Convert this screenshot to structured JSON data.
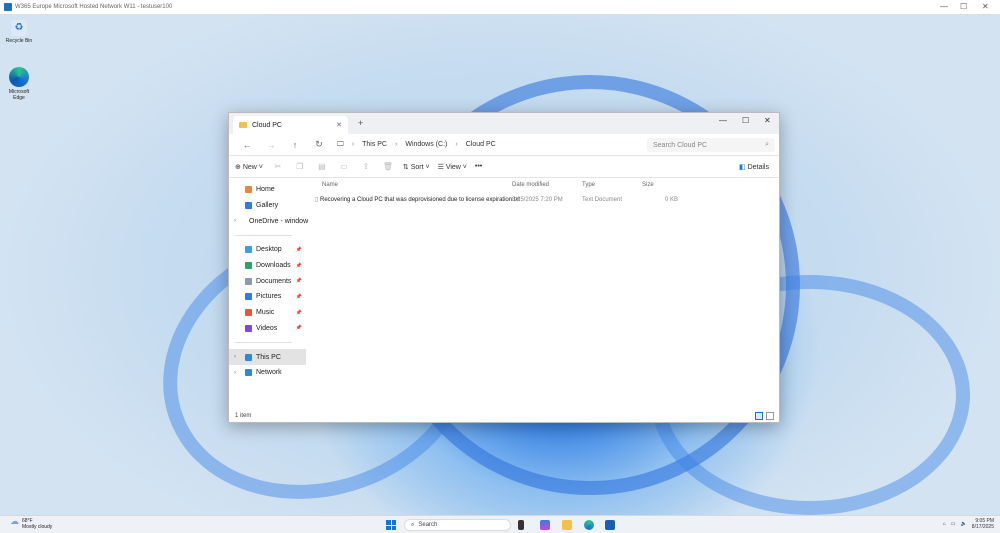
{
  "rdp": {
    "title": "W365 Europe Microsoft Hosted Network W11 - testuser100"
  },
  "desktop": {
    "icons": [
      {
        "label": "Recycle Bin"
      },
      {
        "label": "Microsoft Edge"
      }
    ]
  },
  "explorer": {
    "tab": "Cloud PC",
    "breadcrumbs": [
      "This PC",
      "Windows (C:)",
      "Cloud PC"
    ],
    "search_placeholder": "Search Cloud PC",
    "toolbar": {
      "new": "New",
      "sort": "Sort",
      "view": "View",
      "more": "•••",
      "details": "Details"
    },
    "sidebar": [
      {
        "label": "Home",
        "icon": "home-icon",
        "color": "#e8873a"
      },
      {
        "label": "Gallery",
        "icon": "gallery-icon",
        "color": "#2b7de0"
      },
      {
        "label": "OneDrive - window",
        "icon": "cloud-icon",
        "color": "#1a73d9"
      },
      {
        "label": "Desktop",
        "icon": "desktop-icon",
        "color": "#3aa0e0",
        "pinned": true
      },
      {
        "label": "Downloads",
        "icon": "download-icon",
        "color": "#2aa36b",
        "pinned": true
      },
      {
        "label": "Documents",
        "icon": "documents-icon",
        "color": "#8a9bb0",
        "pinned": true
      },
      {
        "label": "Pictures",
        "icon": "pictures-icon",
        "color": "#2b7de0",
        "pinned": true
      },
      {
        "label": "Music",
        "icon": "music-icon",
        "color": "#e05a3a",
        "pinned": true
      },
      {
        "label": "Videos",
        "icon": "videos-icon",
        "color": "#7b4ad8",
        "pinned": true
      },
      {
        "label": "This PC",
        "icon": "pc-icon",
        "color": "#2b8ad8",
        "selected": true
      },
      {
        "label": "Network",
        "icon": "network-icon",
        "color": "#2b8ad8"
      }
    ],
    "columns": [
      "Name",
      "Date modified",
      "Type",
      "Size"
    ],
    "files": [
      {
        "name": "Recovering a Cloud PC that was deprovisioned due to license expiration.txt",
        "date": "8/15/2025 7:20 PM",
        "type": "Text Document",
        "size": "0 KB"
      }
    ],
    "status": "1 item"
  },
  "taskbar": {
    "temp": "68°F",
    "weather": "Mostly cloudy",
    "search": "Search",
    "time": "9:05 PM",
    "date": "8/17/2025"
  }
}
